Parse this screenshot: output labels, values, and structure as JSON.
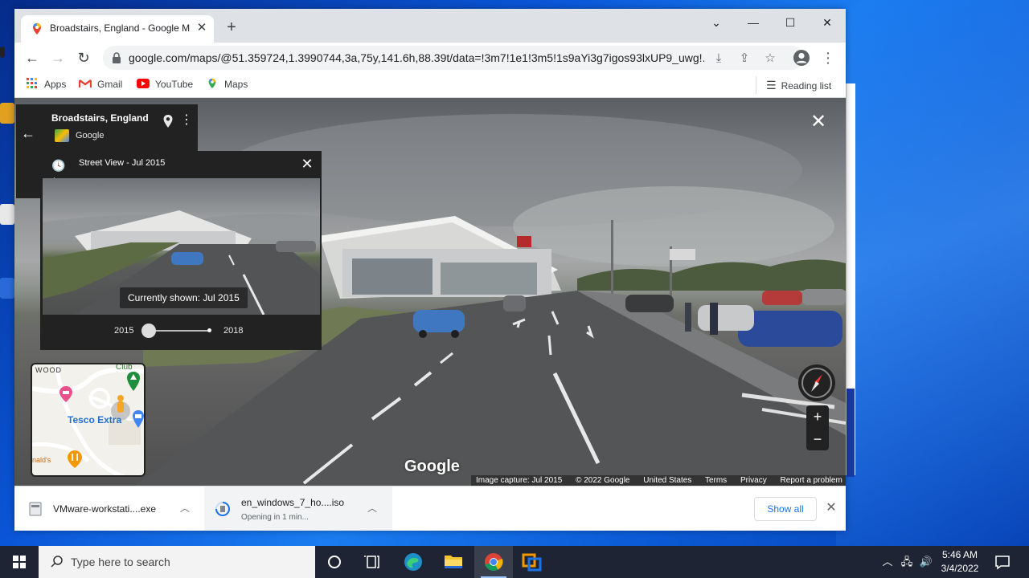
{
  "browser": {
    "tab_title": "Broadstairs, England - Google M",
    "url": "google.com/maps/@51.359724,1.3990744,3a,75y,141.6h,88.39t/data=!3m7!1e1!3m5!1s9aYi3g7igos93lxUP9_uwg!...",
    "bookmarks": [
      {
        "label": "Apps",
        "icon": "apps-grid-icon"
      },
      {
        "label": "Gmail",
        "icon": "gmail-icon"
      },
      {
        "label": "YouTube",
        "icon": "youtube-icon"
      },
      {
        "label": "Maps",
        "icon": "maps-icon"
      }
    ],
    "reading_list": "Reading list"
  },
  "streetview": {
    "place_name": "Broadstairs, England",
    "place_source": "Google",
    "time_header": "Street View - Jul 2015",
    "currently_shown": "Currently shown: Jul 2015",
    "year_start": "2015",
    "year_end": "2018",
    "slider_fraction": 0,
    "logo": "Google",
    "minimap": {
      "label_wood": "WOOD",
      "label_club": "Club",
      "label_tesco": "Tesco Extra",
      "label_bottom": "nald's"
    },
    "attribution": [
      "Image capture: Jul 2015",
      "© 2022 Google",
      "United States",
      "Terms",
      "Privacy",
      "Report a problem"
    ]
  },
  "downloads": [
    {
      "name": "VMware-workstati....exe",
      "status": ""
    },
    {
      "name": "en_windows_7_ho....iso",
      "status": "Opening in 1 min..."
    }
  ],
  "downloads_show_all": "Show all",
  "taskbar": {
    "search_placeholder": "Type here to search",
    "time": "5:46 AM",
    "date": "3/4/2022"
  },
  "colors": {
    "accent": "#1a73e8",
    "taskbar": "#1e2433",
    "dark_panel": "#222222"
  }
}
